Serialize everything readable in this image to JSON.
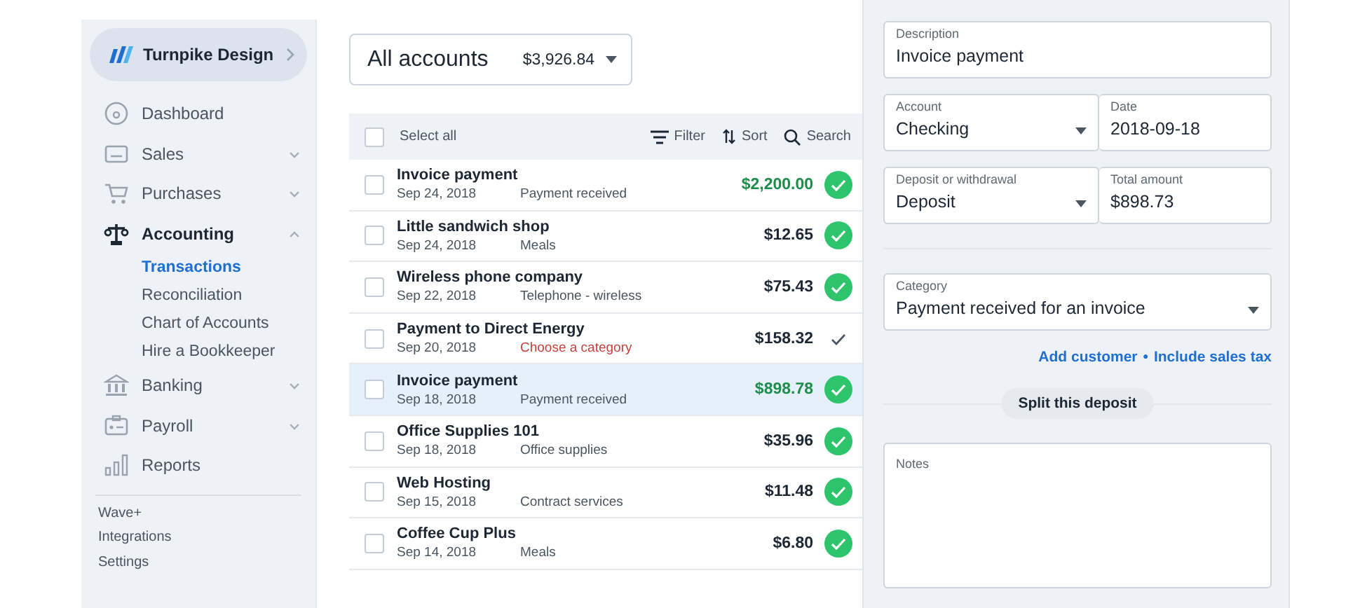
{
  "sidebar": {
    "business": "Turnpike Design",
    "items": [
      {
        "label": "Dashboard",
        "kind": "link",
        "expanded": false
      },
      {
        "label": "Sales",
        "kind": "menu",
        "expanded": false
      },
      {
        "label": "Purchases",
        "kind": "menu",
        "expanded": false
      },
      {
        "label": "Accounting",
        "kind": "menu",
        "expanded": true,
        "children": [
          {
            "label": "Transactions",
            "selected": true
          },
          {
            "label": "Reconciliation",
            "selected": false
          },
          {
            "label": "Chart of Accounts",
            "selected": false
          },
          {
            "label": "Hire a Bookkeeper",
            "selected": false
          }
        ]
      },
      {
        "label": "Banking",
        "kind": "menu",
        "expanded": false
      },
      {
        "label": "Payroll",
        "kind": "menu",
        "expanded": false
      },
      {
        "label": "Reports",
        "kind": "link",
        "expanded": false
      }
    ],
    "footer_links": [
      "Wave+",
      "Integrations",
      "Settings"
    ]
  },
  "account_selector": {
    "label": "All accounts",
    "balance": "$3,926.84"
  },
  "toolbar": {
    "select_all": "Select all",
    "select_all_checked": false,
    "filter": "Filter",
    "sort": "Sort",
    "search": "Search"
  },
  "transactions": [
    {
      "title": "Invoice payment",
      "date": "Sep 24, 2018",
      "category": "Payment received",
      "amount": "$2,200.00",
      "income": true,
      "uncategorized": false,
      "reviewed": true,
      "selected": false,
      "checked": false
    },
    {
      "title": "Little sandwich shop",
      "date": "Sep 24, 2018",
      "category": "Meals",
      "amount": "$12.65",
      "income": false,
      "uncategorized": false,
      "reviewed": true,
      "selected": false,
      "checked": false
    },
    {
      "title": "Wireless phone company",
      "date": "Sep 22, 2018",
      "category": "Telephone - wireless",
      "amount": "$75.43",
      "income": false,
      "uncategorized": false,
      "reviewed": true,
      "selected": false,
      "checked": false
    },
    {
      "title": "Payment to Direct Energy",
      "date": "Sep 20, 2018",
      "category": "Choose a category",
      "amount": "$158.32",
      "income": false,
      "uncategorized": true,
      "reviewed": false,
      "selected": false,
      "checked": false
    },
    {
      "title": "Invoice payment",
      "date": "Sep 18, 2018",
      "category": "Payment received",
      "amount": "$898.78",
      "income": true,
      "uncategorized": false,
      "reviewed": true,
      "selected": true,
      "checked": false
    },
    {
      "title": "Office Supplies 101",
      "date": "Sep 18, 2018",
      "category": "Office supplies",
      "amount": "$35.96",
      "income": false,
      "uncategorized": false,
      "reviewed": true,
      "selected": false,
      "checked": false
    },
    {
      "title": "Web Hosting",
      "date": "Sep 15, 2018",
      "category": "Contract services",
      "amount": "$11.48",
      "income": false,
      "uncategorized": false,
      "reviewed": true,
      "selected": false,
      "checked": false
    },
    {
      "title": "Coffee Cup Plus",
      "date": "Sep 14, 2018",
      "category": "Meals",
      "amount": "$6.80",
      "income": false,
      "uncategorized": false,
      "reviewed": true,
      "selected": false,
      "checked": false
    }
  ],
  "detail": {
    "fields": [
      {
        "label": "Description",
        "value": "Invoice payment",
        "kind": "text"
      },
      {
        "label": "Account",
        "value": "Checking",
        "kind": "select"
      },
      {
        "label": "Date",
        "value": "2018-09-18",
        "kind": "text"
      },
      {
        "label": "Deposit or withdrawal",
        "value": "Deposit",
        "kind": "select"
      },
      {
        "label": "Total amount",
        "value": "$898.73",
        "kind": "text"
      },
      {
        "label": "Category",
        "value": "Payment received for an invoice",
        "kind": "select"
      }
    ],
    "links": [
      "Add customer",
      "Include sales tax"
    ],
    "link_separator": "•",
    "split_button": "Split this deposit",
    "notes": {
      "label": "Notes"
    }
  }
}
